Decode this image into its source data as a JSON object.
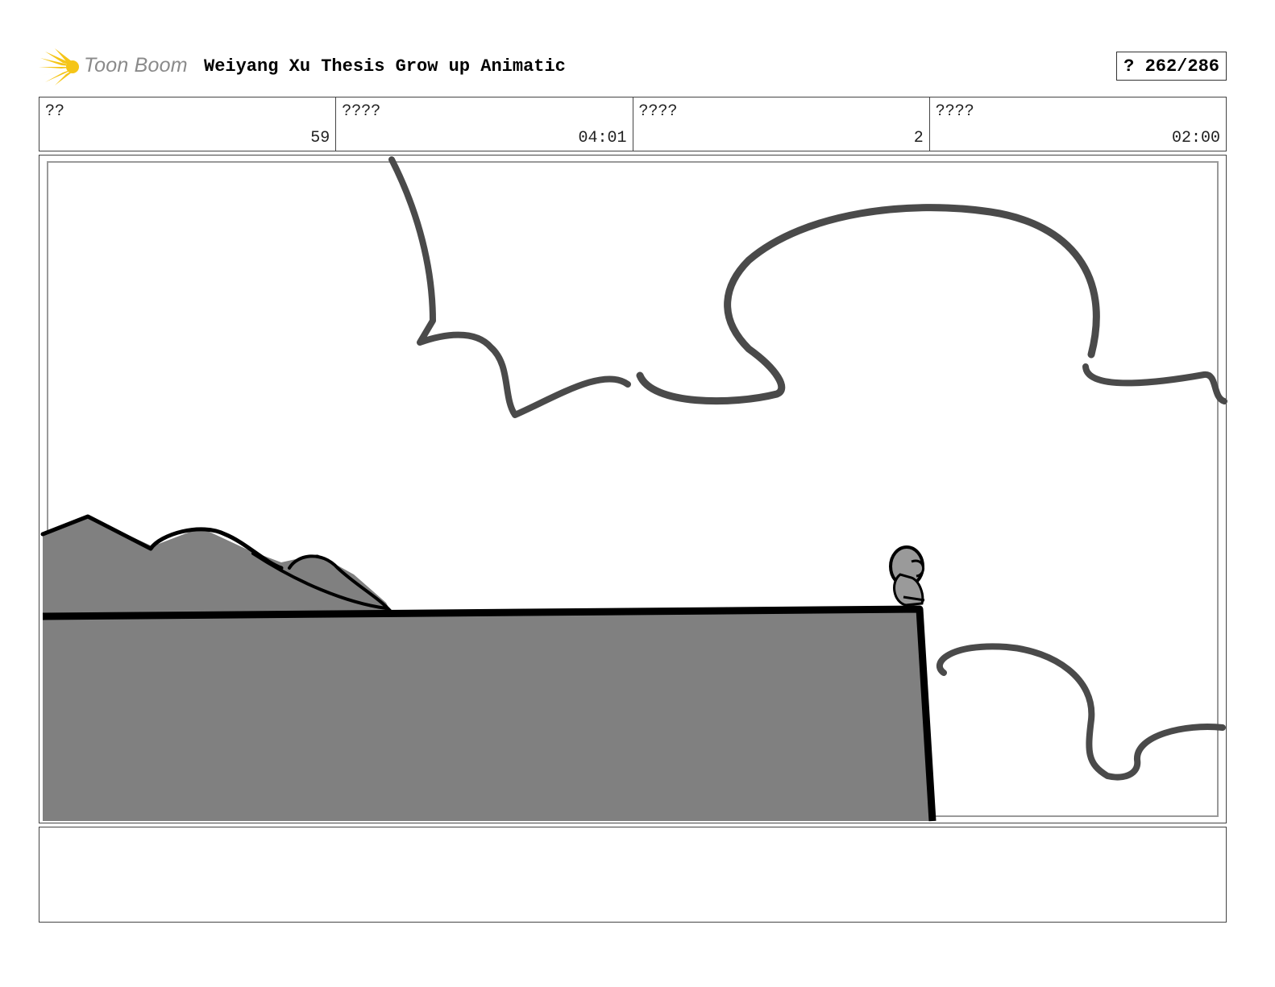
{
  "header": {
    "logo_text": "Toon Boom",
    "title": "Weiyang Xu Thesis Grow up Animatic",
    "page_counter": "? 262/286"
  },
  "info": [
    {
      "label": "??",
      "value": "59"
    },
    {
      "label": "????",
      "value": "04:01"
    },
    {
      "label": "????",
      "value": "2"
    },
    {
      "label": "????",
      "value": "02:00"
    }
  ],
  "notes": {
    "text": ""
  },
  "colors": {
    "logo_yellow": "#f5c518",
    "sketch_stroke": "#4a4a4a",
    "ground_fill": "#808080",
    "outline": "#000000"
  }
}
